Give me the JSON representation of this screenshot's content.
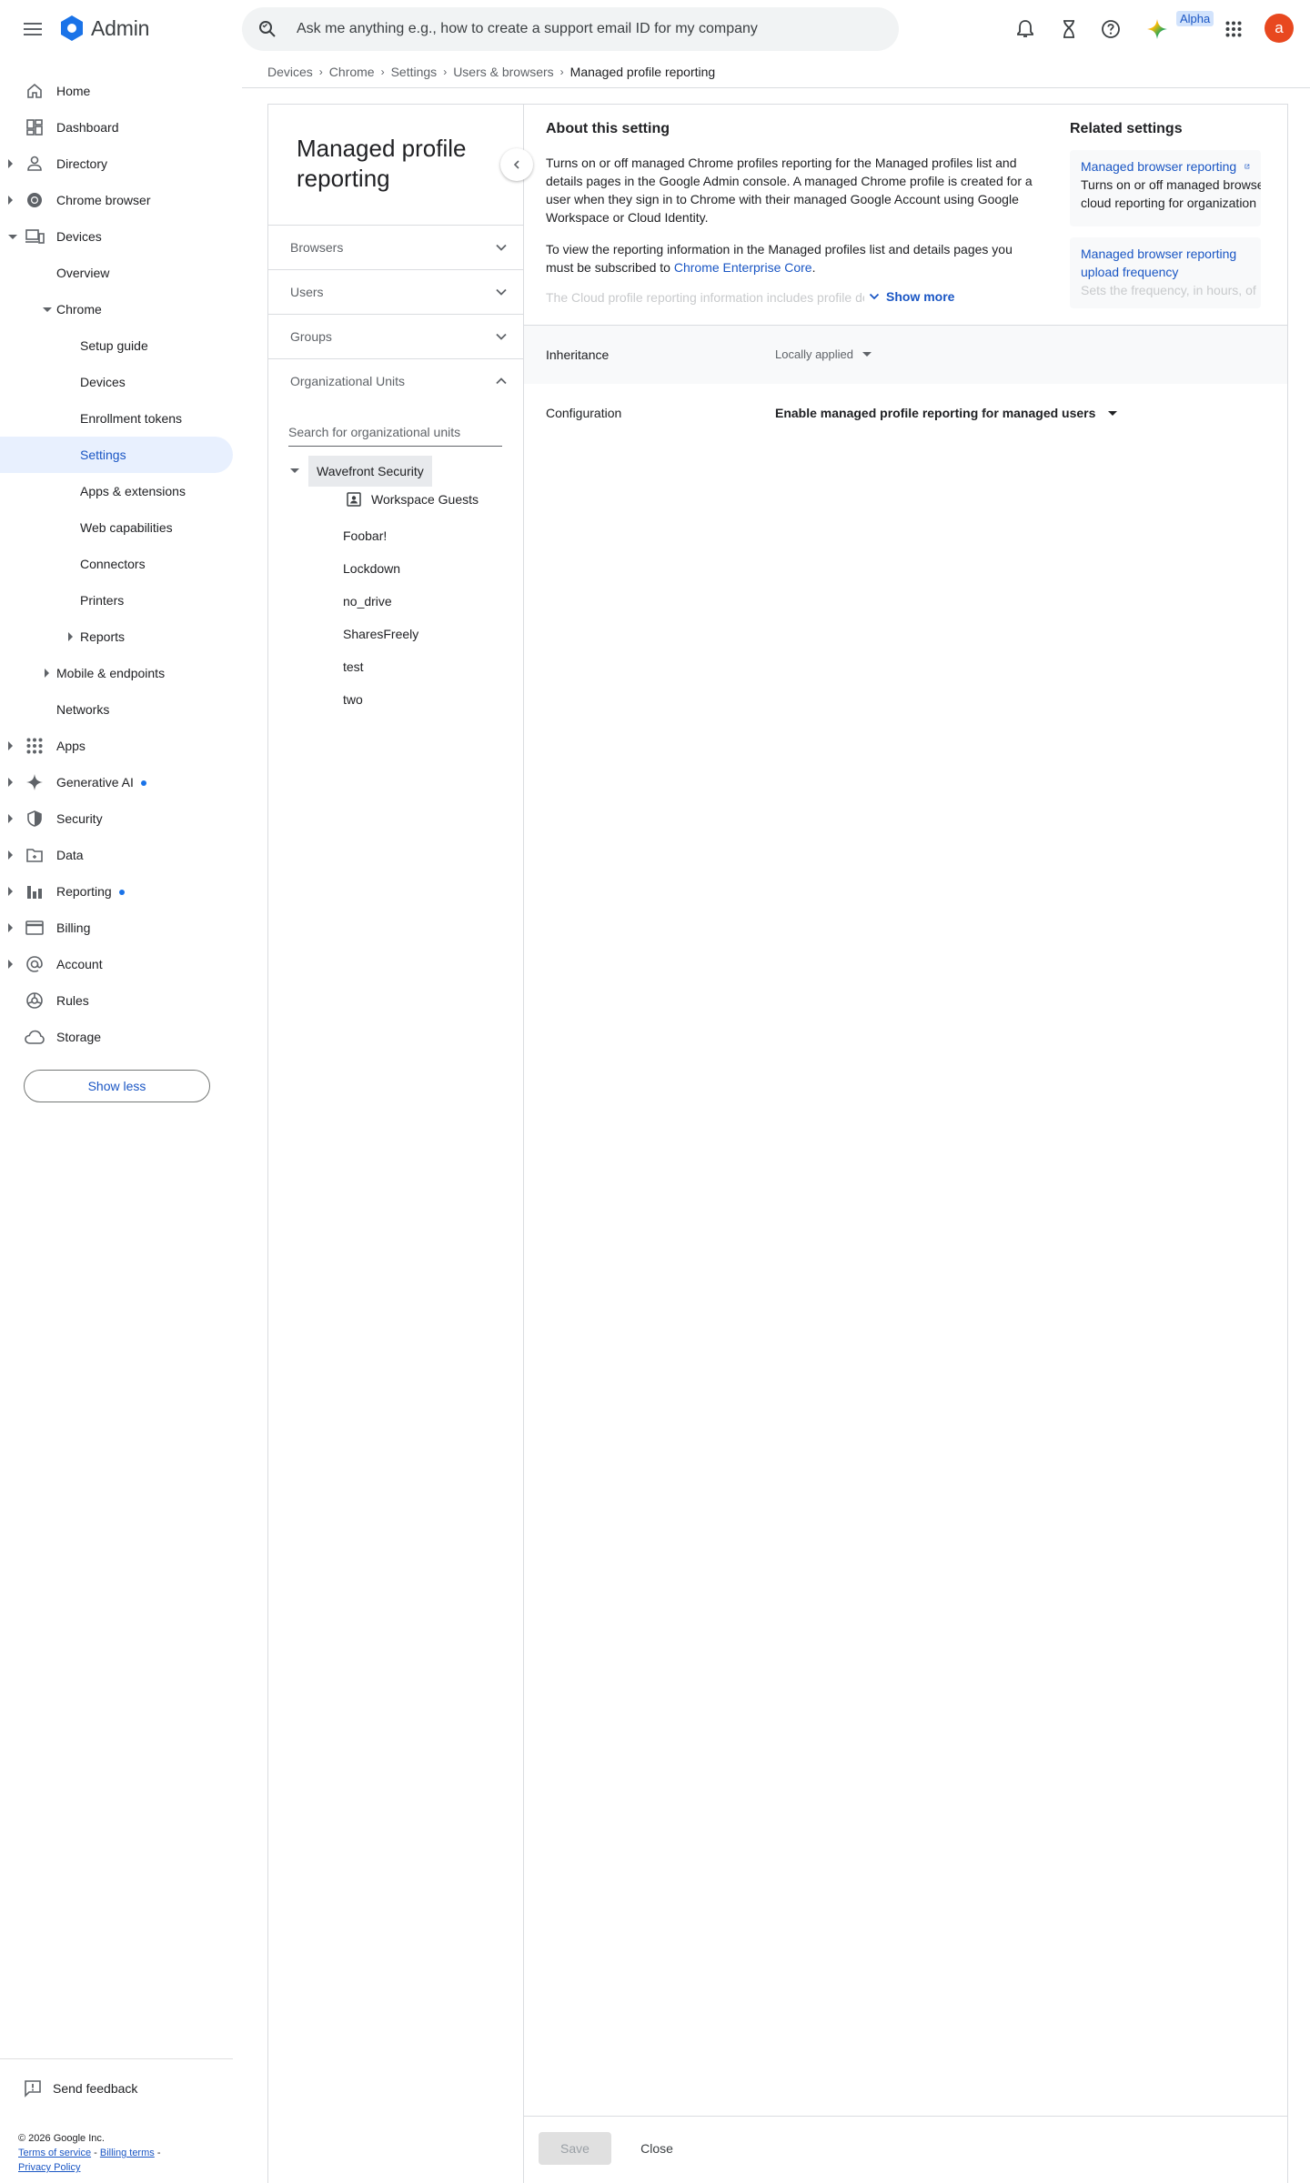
{
  "app": {
    "title": "Admin"
  },
  "search": {
    "placeholder": "Ask me anything e.g., how to create a support email ID for my company"
  },
  "topbar": {
    "alpha_badge": "Alpha",
    "avatar_letter": "a"
  },
  "breadcrumb": [
    "Devices",
    "Chrome",
    "Settings",
    "Users & browsers",
    "Managed profile reporting"
  ],
  "sidebar": {
    "items": [
      {
        "label": "Home",
        "icon": "home-icon"
      },
      {
        "label": "Dashboard",
        "icon": "dashboard-icon"
      },
      {
        "label": "Directory",
        "icon": "person-icon"
      },
      {
        "label": "Chrome browser",
        "icon": "chrome-icon"
      },
      {
        "label": "Devices",
        "icon": "devices-icon"
      },
      {
        "label": "Overview"
      },
      {
        "label": "Chrome"
      },
      {
        "label": "Setup guide"
      },
      {
        "label": "Devices"
      },
      {
        "label": "Enrollment tokens"
      },
      {
        "label": "Settings"
      },
      {
        "label": "Apps & extensions"
      },
      {
        "label": "Web capabilities"
      },
      {
        "label": "Connectors"
      },
      {
        "label": "Printers"
      },
      {
        "label": "Reports"
      },
      {
        "label": "Mobile & endpoints"
      },
      {
        "label": "Networks"
      },
      {
        "label": "Apps",
        "icon": "apps-grid-icon"
      },
      {
        "label": "Generative AI",
        "icon": "sparkle-icon"
      },
      {
        "label": "Security",
        "icon": "shield-icon"
      },
      {
        "label": "Data",
        "icon": "folder-icon"
      },
      {
        "label": "Reporting",
        "icon": "bar-chart-icon"
      },
      {
        "label": "Billing",
        "icon": "credit-card-icon"
      },
      {
        "label": "Account",
        "icon": "at-sign-icon"
      },
      {
        "label": "Rules",
        "icon": "rules-icon"
      },
      {
        "label": "Storage",
        "icon": "cloud-icon"
      }
    ],
    "show_less": "Show less",
    "send_feedback": "Send feedback"
  },
  "footer": {
    "copyright": "© 2026 Google Inc.",
    "terms": "Terms of service",
    "billing_terms": "Billing terms",
    "privacy": "Privacy Policy"
  },
  "left_panel": {
    "title": "Managed profile reporting",
    "accordions": [
      "Browsers",
      "Users",
      "Groups",
      "Organizational Units"
    ],
    "ou_search_placeholder": "Search for organizational units",
    "ou_root": "Wavefront Security",
    "ou_guest": "Workspace Guests",
    "ou_children": [
      "Foobar!",
      "Lockdown",
      "no_drive",
      "SharesFreely",
      "test",
      "two"
    ]
  },
  "about": {
    "title": "About this setting",
    "p1": "Turns on or off managed Chrome profiles reporting for the Managed profiles list and details pages in the Google Admin console. A managed Chrome profile is created for a user when they sign in to Chrome with their managed Google Account using Google Workspace or Cloud Identity.",
    "p2_prefix": "To view the reporting information in the Managed profiles list and details pages you must be subscribed to ",
    "p2_link": "Chrome Enterprise Core",
    "p2_suffix": ".",
    "p3_faded": "The Cloud profile reporting information includes profile details, browser",
    "show_more": "Show more"
  },
  "related": {
    "title": "Related settings",
    "items": [
      {
        "link": "Managed browser reporting",
        "desc": "Turns on or off managed browser cloud reporting for organization"
      },
      {
        "link": "Managed browser reporting upload frequency",
        "desc": "Sets the frequency, in hours, of"
      }
    ]
  },
  "settings": {
    "inheritance_label": "Inheritance",
    "inheritance_value": "Locally applied",
    "configuration_label": "Configuration",
    "configuration_value": "Enable managed profile reporting for managed users"
  },
  "actions": {
    "save": "Save",
    "close": "Close"
  },
  "colors": {
    "accent": "#1a73e8",
    "link": "#1a56c4",
    "avatar": "#e8481f",
    "active_nav_bg": "#e8f0fe"
  }
}
